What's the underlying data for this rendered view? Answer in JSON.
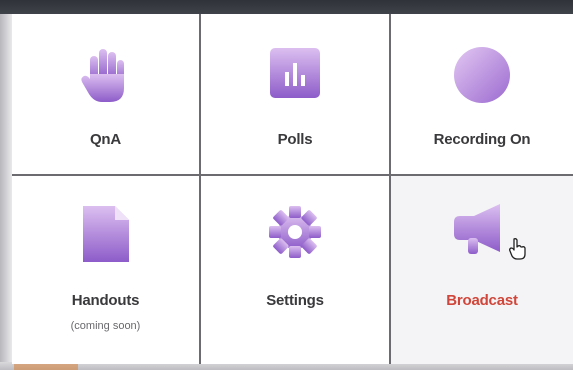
{
  "tiles": [
    {
      "label": "QnA",
      "icon": "hand-icon"
    },
    {
      "label": "Polls",
      "icon": "poll-chart-icon"
    },
    {
      "label": "Recording On",
      "icon": "record-circle-icon"
    },
    {
      "label": "Handouts",
      "sublabel": "(coming soon)",
      "icon": "document-icon"
    },
    {
      "label": "Settings",
      "icon": "gear-icon"
    },
    {
      "label": "Broadcast",
      "icon": "megaphone-icon"
    }
  ],
  "colors": {
    "icon_gradient_top": "#dcbff0",
    "icon_gradient_bottom": "#8d5cc9",
    "broadcast_label": "#d0463a"
  }
}
